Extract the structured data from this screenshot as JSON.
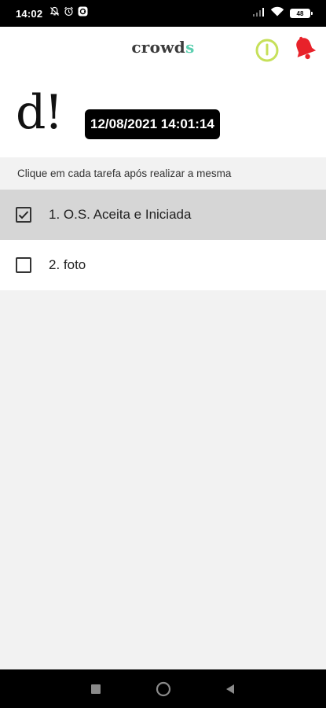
{
  "status_bar": {
    "time": "14:02",
    "battery_level": "48",
    "icons": [
      "notifications-off-icon",
      "alarm-icon",
      "app-notification-icon",
      "signal-icon",
      "wifi-icon",
      "battery-icon"
    ]
  },
  "header": {
    "logo_main": "crowd",
    "logo_accent": "s",
    "colors": {
      "logo": "#3c3c3c",
      "logo_accent": "#5ccfb0",
      "power": "#c6e05a",
      "bell": "#e8222a"
    }
  },
  "hero": {
    "mark": "d!",
    "datetime": "12/08/2021 14:01:14"
  },
  "instructions": "Clique em cada tarefa após realizar a mesma",
  "tasks": [
    {
      "label": "1. O.S. Aceita e Iniciada",
      "checked": true
    },
    {
      "label": "2. foto",
      "checked": false
    }
  ],
  "nav_bar": {
    "buttons": [
      "recents-button",
      "home-button",
      "back-button"
    ]
  }
}
